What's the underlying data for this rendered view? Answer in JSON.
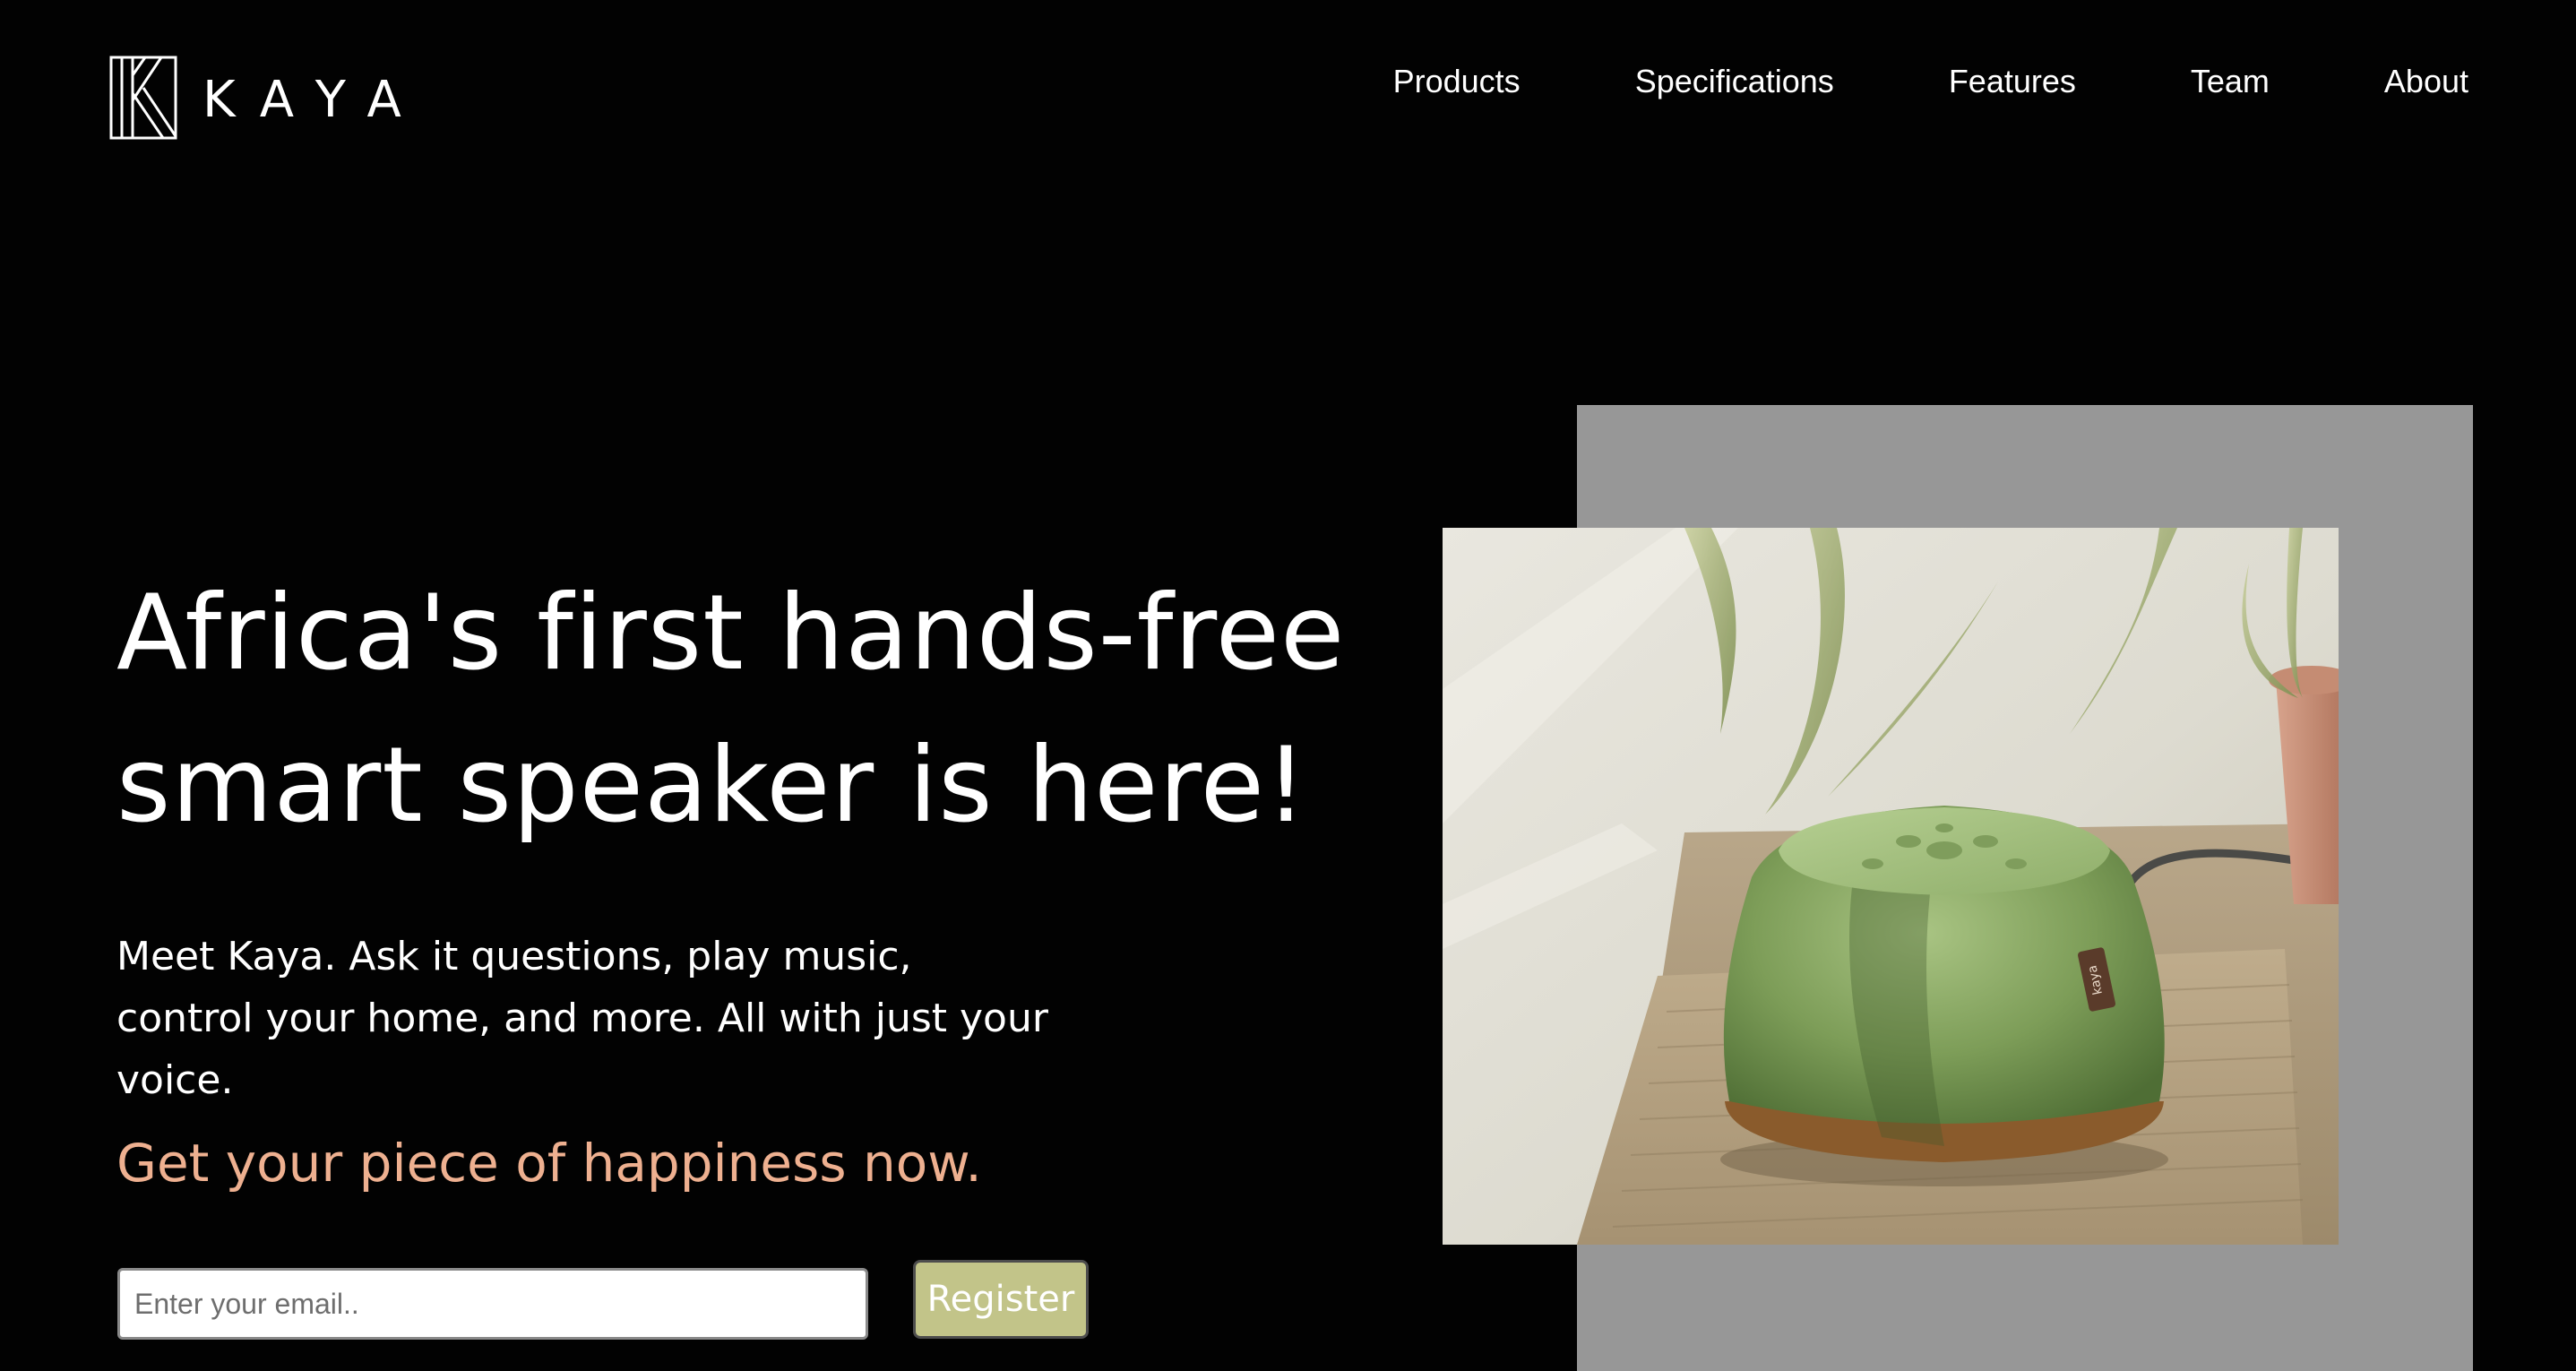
{
  "brand": {
    "name": "KAYA",
    "logo_icon": "kaya-k-monogram-icon"
  },
  "nav": {
    "items": [
      {
        "label": "Products"
      },
      {
        "label": "Specifications"
      },
      {
        "label": "Features"
      },
      {
        "label": "Team"
      },
      {
        "label": "About"
      }
    ]
  },
  "hero": {
    "title": "Africa's first hands-free smart speaker is here!",
    "subtitle": "Meet Kaya. Ask it questions, play music, control your home, and more. All with just your voice.",
    "cta_text": "Get your piece of happiness now."
  },
  "form": {
    "email_placeholder": "Enter your email..",
    "email_value": "",
    "register_label": "Register"
  },
  "image": {
    "description_icon": "kaya-speaker-product-photo",
    "speaker_label": "kaya"
  },
  "colors": {
    "background": "#020202",
    "text": "#ffffff",
    "accent_cta": "#eeb090",
    "register_button": "#c2c489",
    "grey_panel": "#979797",
    "speaker_green": "#8fae6a"
  }
}
